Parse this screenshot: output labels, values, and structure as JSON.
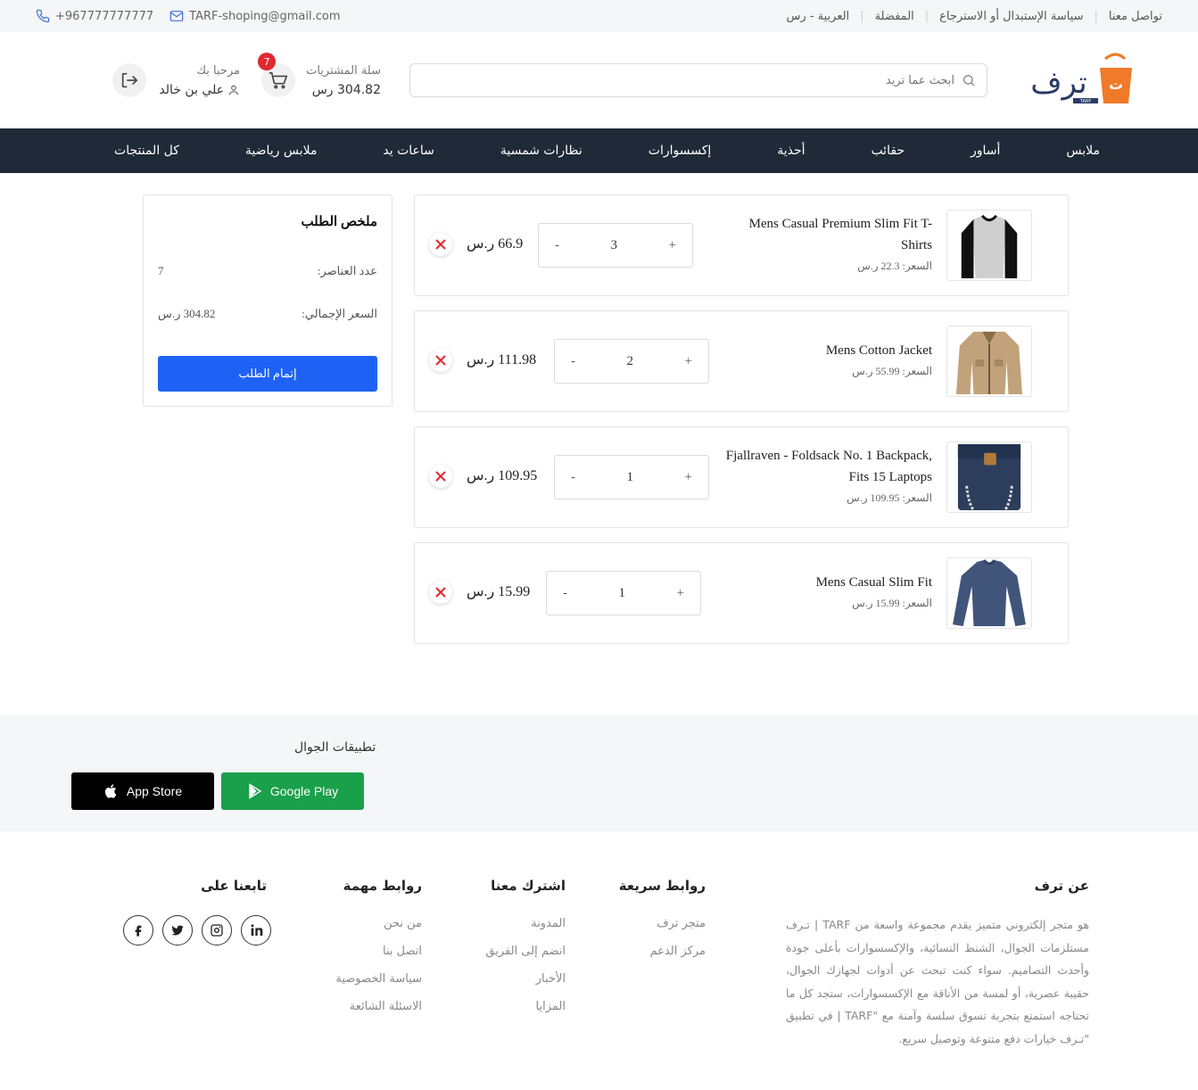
{
  "topbar": {
    "links": [
      "تواصل معنا",
      "سياسة الإستبدال أو الاسترجاع",
      "المفضلة",
      "العربية - رس"
    ],
    "email": "TARF-shoping@gmail.com",
    "phone": "+967777777777"
  },
  "header": {
    "logo_text": "تـرف",
    "logo_sub": "TARF",
    "search_placeholder": "ابحث عما تريد",
    "cart_label": "سلة المشتريات",
    "cart_amount": "304.82 رس",
    "cart_count": "7",
    "welcome": "مرحبا بك",
    "user_name": "علي بن خالد"
  },
  "nav": [
    "ملابس",
    "أساور",
    "حقائب",
    "أحذية",
    "إكسسوارات",
    "نظارات شمسية",
    "ساعات يد",
    "ملابس رياضية",
    "كل المنتجات"
  ],
  "cart_items": [
    {
      "title": "Mens Casual Premium Slim Fit T-Shirts",
      "price": "السعر: 22.3 ر.س",
      "qty": "3",
      "total": "66.9 ر.س",
      "minus": "-",
      "plus": "+"
    },
    {
      "title": "Mens Cotton Jacket",
      "price": "السعر: 55.99 ر.س",
      "qty": "2",
      "total": "111.98 ر.س",
      "minus": "-",
      "plus": "+"
    },
    {
      "title": "Fjallraven - Foldsack No. 1 Backpack, Fits 15 Laptops",
      "price": "السعر: 109.95 ر.س",
      "qty": "1",
      "total": "109.95 ر.س",
      "minus": "-",
      "plus": "+"
    },
    {
      "title": "Mens Casual Slim Fit",
      "price": "السعر: 15.99 ر.س",
      "qty": "1",
      "total": "15.99 ر.س",
      "minus": "-",
      "plus": "+"
    }
  ],
  "summary": {
    "title": "ملخص الطلب",
    "items_label": "عدد العناصر:",
    "items_value": "7",
    "total_label": "السعر الإجمالي:",
    "total_value": "304.82 ر.س",
    "checkout": "إتمام الطلب"
  },
  "apps": {
    "title": "تطبيقات الجوال",
    "app_store": "App Store",
    "google_play": "Google Play"
  },
  "footer": {
    "about_title": "عن ترف",
    "about_text": "هو متجر إلكتروني متميز يقدم مجموعة واسعة من TARF | تـرف مستلزمات الجوال، الشنط النسائية، والإكسسوارات بأعلى جودة وأحدث التصاميم. سواء كنت تبحث عن أدوات لجهازك الجوال، حقيبة عصرية، أو لمسة من الأناقة مع الإكسسوارات، ستجد كل ما تحتاجه استمتع بتجربة تسوق سلسة وآمنة مع \"TARF | في تطبيق \"تـرف خيارات دفع متنوعة وتوصيل سريع.",
    "quick_title": "روابط سريعة",
    "quick_links": [
      "متجر ترف",
      "مركز الدعم"
    ],
    "subscribe_title": "اشترك معنا",
    "subscribe_links": [
      "المدونة",
      "انضم إلى الفريق",
      "الأخبار",
      "المزايا"
    ],
    "important_title": "روابط مهمة",
    "important_links": [
      "من نحن",
      "اتصل بنا",
      "سياسة الخصوصية",
      "الاسئلة الشائعة"
    ],
    "follow_title": "تابعنا على",
    "social_icons": [
      "linkedin-icon",
      "instagram-icon",
      "twitter-icon",
      "facebook-icon"
    ]
  },
  "colors": {
    "nav_bg": "#1f2937",
    "accent": "#1e62f5",
    "logo_orange": "#f07a2a",
    "logo_navy": "#2b3a67",
    "remove": "#e0292f",
    "google_green": "#1aa04a"
  }
}
